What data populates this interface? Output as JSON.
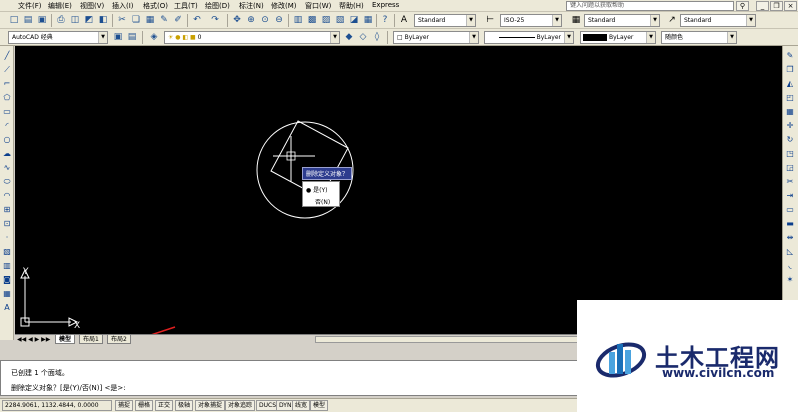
{
  "menu": [
    "文件(F)",
    "编辑(E)",
    "视图(V)",
    "插入(I)",
    "格式(O)",
    "工具(T)",
    "绘图(D)",
    "标注(N)",
    "修改(M)",
    "窗口(W)",
    "帮助(H)",
    "Express"
  ],
  "help_search_placeholder": "键入问题以获取帮助",
  "toolbar1": {
    "text_style": "Standard",
    "dim_style": "ISO-25",
    "table_style": "Standard",
    "multileader_style": "Standard"
  },
  "toolbar2": {
    "workspace": "AutoCAD 经典",
    "layer": "0",
    "color": "ByLayer",
    "linetype": "ByLayer",
    "lineweight": "ByLayer",
    "plotstyle": "随颜色"
  },
  "context_menu": {
    "title": "删除定义对象？",
    "options": [
      {
        "label": "是(Y)",
        "selected": true
      },
      {
        "label": "否(N)",
        "selected": false
      }
    ]
  },
  "ucs": {
    "x_label": "X",
    "y_label": "Y"
  },
  "tabs": [
    "模型",
    "布局1",
    "布局2"
  ],
  "command_lines": [
    "已创建 1 个面域。",
    "删除定义对象？[是(Y)/否(N)] <是>:"
  ],
  "status": {
    "coords": "2284.9061, 1132.4844, 0.0000",
    "toggles": [
      "捕捉",
      "栅格",
      "正交",
      "极轴",
      "对象捕捉",
      "对象追踪",
      "DUCS",
      "DYN",
      "线宽",
      "模型"
    ]
  },
  "watermark": {
    "title": "土木工程网",
    "url": "www.civilcn.com"
  },
  "colors": {
    "canvas": "#000000",
    "drawing": "#ffffff",
    "annotation_arrow": "#e02020",
    "watermark": "#1a2a6c"
  }
}
